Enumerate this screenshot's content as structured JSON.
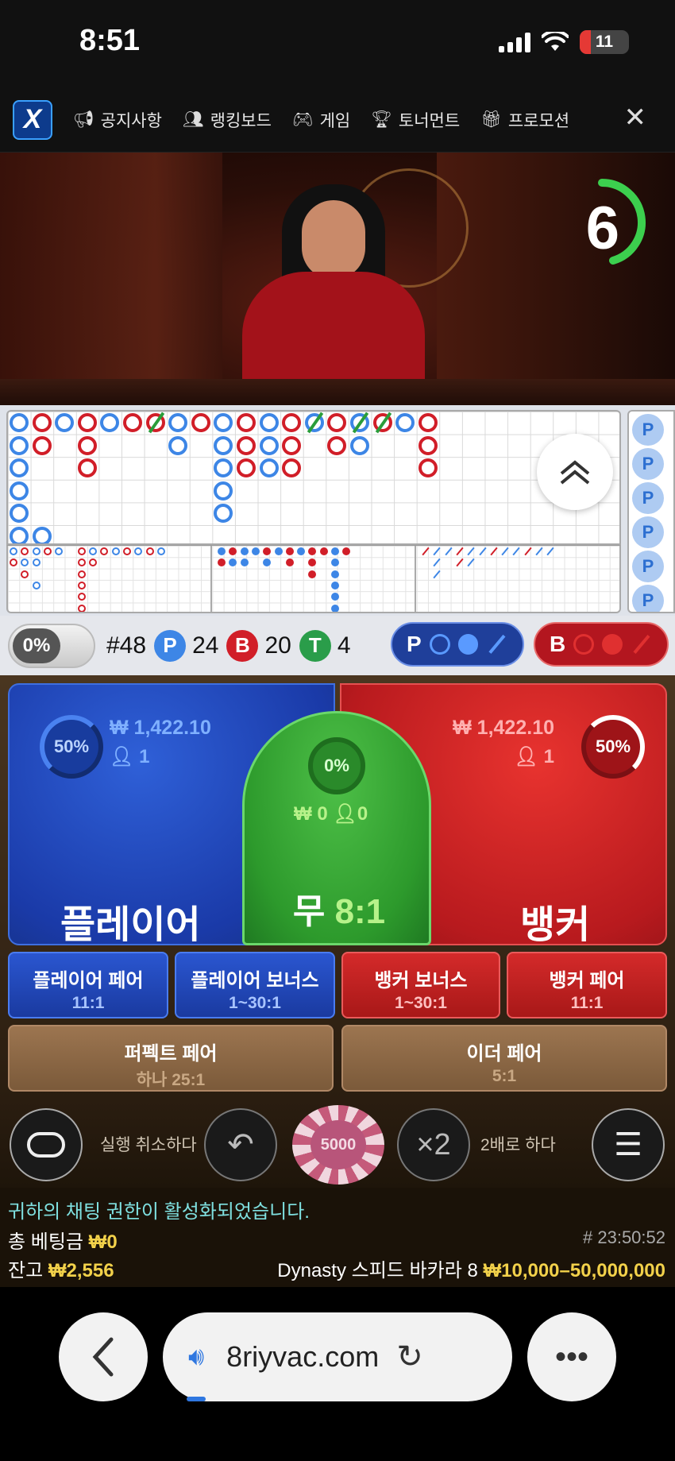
{
  "status_bar": {
    "time": "8:51",
    "battery": "11"
  },
  "nav": {
    "items": [
      {
        "label": "공지사항",
        "icon": "megaphone-icon"
      },
      {
        "label": "랭킹보드",
        "icon": "users-icon"
      },
      {
        "label": "게임",
        "icon": "gamepad-icon"
      },
      {
        "label": "토너먼트",
        "icon": "trophy-icon"
      },
      {
        "label": "프로모션",
        "icon": "gift-icon"
      }
    ]
  },
  "video": {
    "timer": "6"
  },
  "stats": {
    "win_pct": "0%",
    "shoe": "#48",
    "player_label": "P",
    "player_count": "24",
    "banker_label": "B",
    "banker_count": "20",
    "tie_label": "T",
    "tie_count": "4",
    "predict_player": "P",
    "predict_banker": "B"
  },
  "beads": [
    "P",
    "P",
    "P",
    "P",
    "P",
    "P"
  ],
  "player": {
    "pct": "50%",
    "amount": "₩ 1,422.10",
    "bettors": "1",
    "label": "플레이어"
  },
  "banker": {
    "pct": "50%",
    "amount": "₩ 1,422.10",
    "bettors": "1",
    "label": "뱅커"
  },
  "tie": {
    "pct": "0%",
    "amount": "₩ 0",
    "bettors": "0",
    "label": "무",
    "odds": "8:1"
  },
  "side_bets": {
    "player_pair": {
      "label": "플레이어 페어",
      "odds": "11:1"
    },
    "player_bonus": {
      "label": "플레이어 보너스",
      "odds": "1~30:1"
    },
    "banker_bonus": {
      "label": "뱅커 보너스",
      "odds": "1~30:1"
    },
    "banker_pair": {
      "label": "뱅커 페어",
      "odds": "11:1"
    },
    "perfect_pair": {
      "label": "퍼펙트 페어",
      "odds": "하나 25:1"
    },
    "either_pair": {
      "label": "이더 페어",
      "odds": "5:1"
    }
  },
  "controls": {
    "undo_label": "실행 취소하다",
    "chip_value": "5000",
    "double_icon": "×2",
    "double_label": "2배로 하다"
  },
  "info": {
    "chat_msg": "귀하의 채팅 권한이 활성화되었습니다.",
    "total_bet_label": "총 베팅금",
    "total_bet": "₩0",
    "round_id": "# 23:50:52",
    "balance_label": "잔고",
    "balance": "₩2,556",
    "table_name": "Dynasty 스피드 바카라 8",
    "limits": "₩10,000–50,000,000"
  },
  "browser": {
    "url": "8riyvac.com"
  },
  "colors": {
    "player": "#2f60d8",
    "banker": "#d11e28",
    "tie": "#2d9a2c",
    "gold": "#f2d14a"
  }
}
